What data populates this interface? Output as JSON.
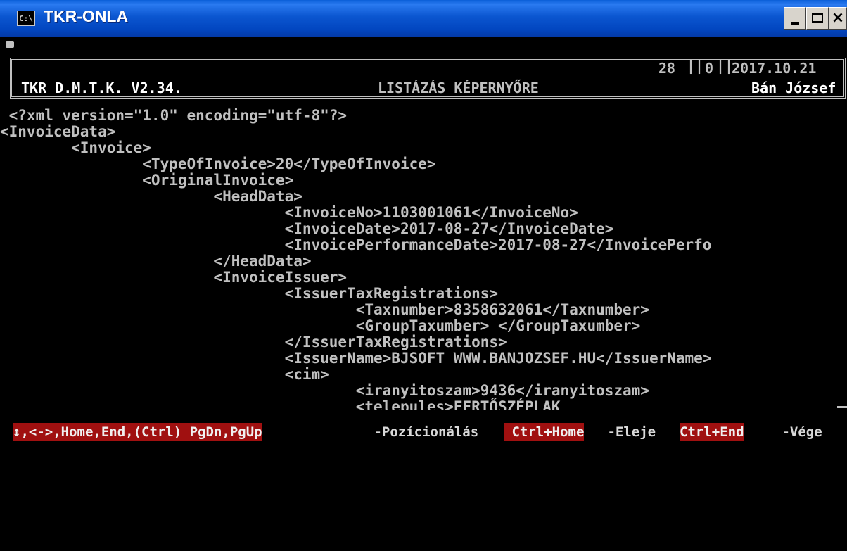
{
  "window": {
    "icon_text": "C:\\",
    "title": "TKR-ONLA",
    "controls": {
      "minimize": "minimize-icon",
      "maximize": "maximize-icon",
      "close": "×"
    }
  },
  "header": {
    "app_name": "TKR D.M.T.K. V2.34.",
    "screen_title": "LISTÁZÁS KÉPERNYŐRE",
    "counter1": "28",
    "counter2": "0",
    "date": "2017.10.21",
    "user": "Bán József"
  },
  "code_lines": [
    " <?xml version=\"1.0\" encoding=\"utf-8\"?>",
    "<InvoiceData>",
    "        <Invoice>",
    "                <TypeOfInvoice>20</TypeOfInvoice>",
    "                <OriginalInvoice>",
    "                        <HeadData>",
    "                                <InvoiceNo>1103001061</InvoiceNo>",
    "                                <InvoiceDate>2017-08-27</InvoiceDate>",
    "                                <InvoicePerformanceDate>2017-08-27</InvoicePerfo",
    "                        </HeadData>",
    "                        <InvoiceIssuer>",
    "                                <IssuerTaxRegistrations>",
    "                                        <Taxnumber>8358632061</Taxnumber>",
    "                                        <GroupTaxumber> </GroupTaxumber>",
    "                                </IssuerTaxRegistrations>",
    "                                <IssuerName>BJSOFT WWW.BANJOZSEF.HU</IssuerName>",
    "                                <cim>",
    "                                        <iranyitoszam>9436</iranyitoszam>",
    "                                        <telepules>FERTŐSZÉPLAK"
  ],
  "status_bar": {
    "keys_nav": "↕,<->,Home,End,(Ctrl) PgDn,PgUp",
    "label_nav": " -Pozícionálás ",
    "keys_home": " Ctrl+Home",
    "label_home": " -Eleje ",
    "keys_end": "Ctrl+End",
    "label_end": " -Vége"
  },
  "colors": {
    "title_bar": "#0b56d0",
    "console_bg": "#000000",
    "console_fg": "#c0c0c0",
    "status_highlight": "#a01010"
  }
}
